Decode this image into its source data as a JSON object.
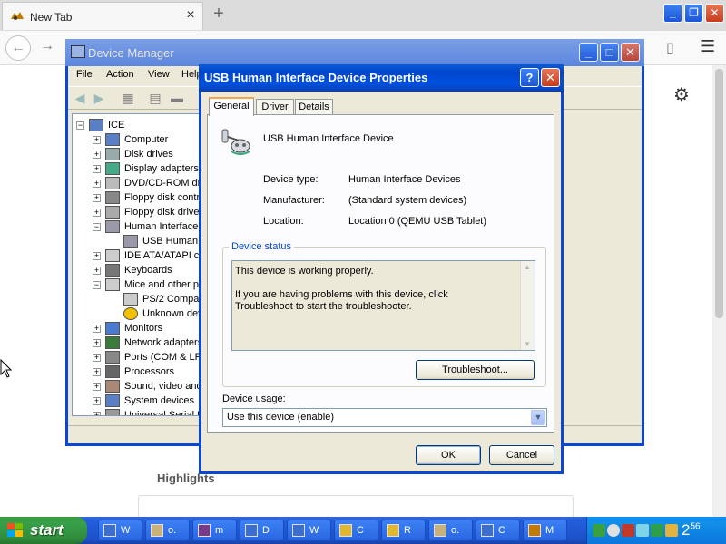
{
  "browser": {
    "tab_title": "New Tab",
    "tab_close": "×",
    "new_tab": "+",
    "minimize": "_",
    "restore": "❐",
    "close": "✕",
    "back": "←",
    "forward": "→",
    "highlights": "Highlights"
  },
  "device_manager": {
    "title": "Device Manager",
    "menu": [
      "File",
      "Action",
      "View",
      "Help"
    ],
    "tree": [
      {
        "label": "ICE",
        "level": 0,
        "toggle": "−",
        "icon": "computer-icon"
      },
      {
        "label": "Computer",
        "level": 1,
        "toggle": "+",
        "icon": "computer-icon"
      },
      {
        "label": "Disk drives",
        "level": 1,
        "toggle": "+",
        "icon": "disk-drive-icon"
      },
      {
        "label": "Display adapters",
        "level": 1,
        "toggle": "+",
        "icon": "display-adapter-icon"
      },
      {
        "label": "DVD/CD-ROM drives",
        "level": 1,
        "toggle": "+",
        "icon": "cdrom-icon"
      },
      {
        "label": "Floppy disk controllers",
        "level": 1,
        "toggle": "+",
        "icon": "floppy-controller-icon"
      },
      {
        "label": "Floppy disk drives",
        "level": 1,
        "toggle": "+",
        "icon": "floppy-drive-icon"
      },
      {
        "label": "Human Interface Devices",
        "level": 1,
        "toggle": "−",
        "icon": "hid-icon"
      },
      {
        "label": "USB Human Interface Device",
        "level": 2,
        "toggle": "",
        "icon": "hid-icon"
      },
      {
        "label": "IDE ATA/ATAPI controllers",
        "level": 1,
        "toggle": "+",
        "icon": "ide-icon"
      },
      {
        "label": "Keyboards",
        "level": 1,
        "toggle": "+",
        "icon": "keyboard-icon"
      },
      {
        "label": "Mice and other pointing devices",
        "level": 1,
        "toggle": "−",
        "icon": "mouse-icon"
      },
      {
        "label": "PS/2 Compatible Mouse",
        "level": 2,
        "toggle": "",
        "icon": "mouse-icon"
      },
      {
        "label": "Unknown device",
        "level": 2,
        "toggle": "",
        "icon": "warning-icon"
      },
      {
        "label": "Monitors",
        "level": 1,
        "toggle": "+",
        "icon": "monitor-icon"
      },
      {
        "label": "Network adapters",
        "level": 1,
        "toggle": "+",
        "icon": "network-adapter-icon"
      },
      {
        "label": "Ports (COM & LPT)",
        "level": 1,
        "toggle": "+",
        "icon": "port-icon"
      },
      {
        "label": "Processors",
        "level": 1,
        "toggle": "+",
        "icon": "processor-icon"
      },
      {
        "label": "Sound, video and game controllers",
        "level": 1,
        "toggle": "+",
        "icon": "sound-icon"
      },
      {
        "label": "System devices",
        "level": 1,
        "toggle": "+",
        "icon": "system-icon"
      },
      {
        "label": "Universal Serial Bus controllers",
        "level": 1,
        "toggle": "+",
        "icon": "usb-icon"
      }
    ]
  },
  "dialog": {
    "title": "USB Human Interface Device Properties",
    "help": "?",
    "close": "✕",
    "tabs": [
      "General",
      "Driver",
      "Details"
    ],
    "device_name": "USB Human Interface Device",
    "device_type_label": "Device type:",
    "device_type": "Human Interface Devices",
    "manufacturer_label": "Manufacturer:",
    "manufacturer": "(Standard system devices)",
    "location_label": "Location:",
    "location": "Location 0 (QEMU USB Tablet)",
    "status_group": "Device status",
    "status_line1": "This device is working properly.",
    "status_line2": "If you are having problems with this device, click Troubleshoot to start the troubleshooter.",
    "troubleshoot": "Troubleshoot...",
    "usage_label": "Device usage:",
    "usage_value": "Use this device (enable)",
    "ok": "OK",
    "cancel": "Cancel"
  },
  "taskbar": {
    "start": "start",
    "items": [
      "W",
      "o.",
      "m",
      "D",
      "W",
      "C",
      "R",
      "o.",
      "C",
      "M"
    ],
    "clock_hour": "2",
    "clock_min": "56"
  },
  "colors": {
    "xp_title_blue": "#0b46d4",
    "dialog_face": "#ece9d8",
    "start_green": "#3c9a3c",
    "status_group_blue": "#0046d5"
  }
}
